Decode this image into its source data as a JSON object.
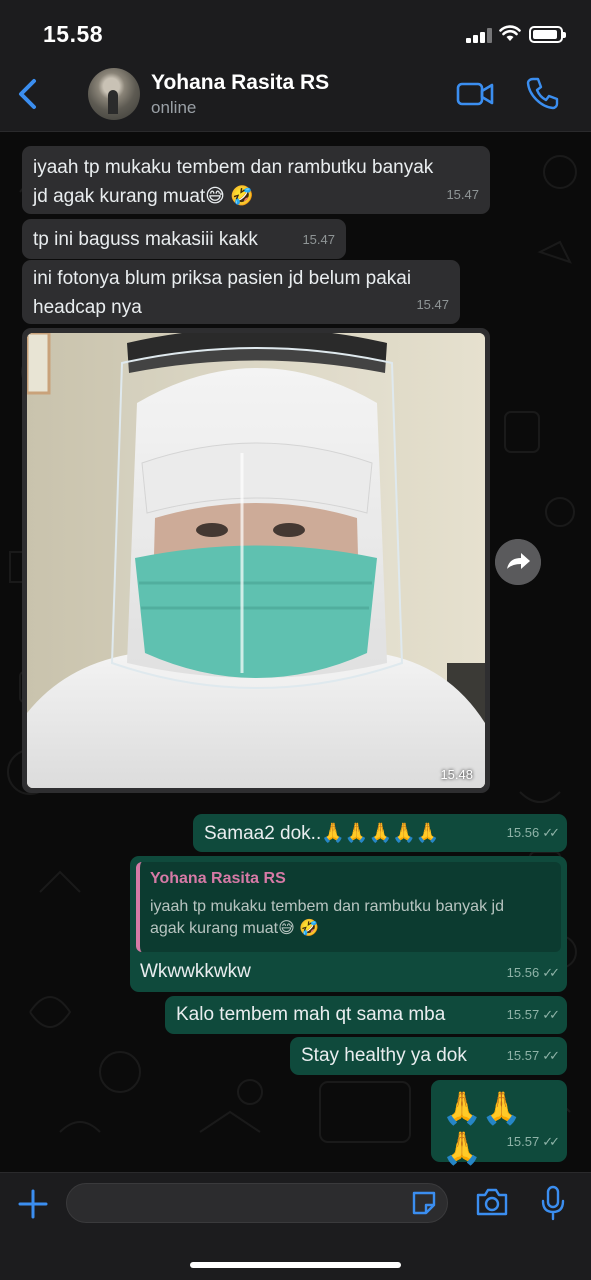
{
  "status_bar": {
    "time": "15.58"
  },
  "header": {
    "contact_name": "Yohana Rasita RS",
    "contact_status": "online"
  },
  "colors": {
    "accent": "#3b8ef0",
    "outgoing_bubble": "#0f4a3c",
    "incoming_bubble": "#2e2e30",
    "quote_name": "#d67aa6"
  },
  "messages": [
    {
      "direction": "in",
      "text_line1": "iyaah tp mukaku tembem dan rambutku banyak",
      "text_line2": "jd agak kurang muat😅 🤣",
      "time": "15.47"
    },
    {
      "direction": "in",
      "text": "tp ini baguss makasiii kakk",
      "time": "15.47"
    },
    {
      "direction": "in",
      "text_line1": "ini fotonya blum priksa pasien jd belum pakai",
      "text_line2": "headcap nya",
      "time": "15.47"
    },
    {
      "direction": "in",
      "type": "photo",
      "time": "15.48"
    },
    {
      "direction": "out",
      "text": "Samaa2 dok..🙏🙏🙏🙏🙏",
      "time": "15.56",
      "status": "read"
    },
    {
      "direction": "out",
      "reply_to": {
        "name": "Yohana Rasita RS",
        "text_line1": "iyaah tp mukaku tembem dan rambutku banyak jd",
        "text_line2": "agak kurang muat😅 🤣"
      },
      "text": "Wkwwkkwkw",
      "time": "15.56",
      "status": "read"
    },
    {
      "direction": "out",
      "text": "Kalo tembem mah qt sama mba",
      "time": "15.57",
      "status": "read"
    },
    {
      "direction": "out",
      "text": "Stay healthy ya dok",
      "time": "15.57",
      "status": "read"
    },
    {
      "direction": "out",
      "text": "🙏🙏🙏",
      "time": "15.57",
      "status": "read"
    }
  ],
  "composer": {
    "value": "",
    "placeholder": ""
  },
  "icons": [
    "back-chevron-icon",
    "video-call-icon",
    "phone-icon",
    "forward-icon",
    "plus-icon",
    "sticker-icon",
    "camera-icon",
    "microphone-icon"
  ]
}
